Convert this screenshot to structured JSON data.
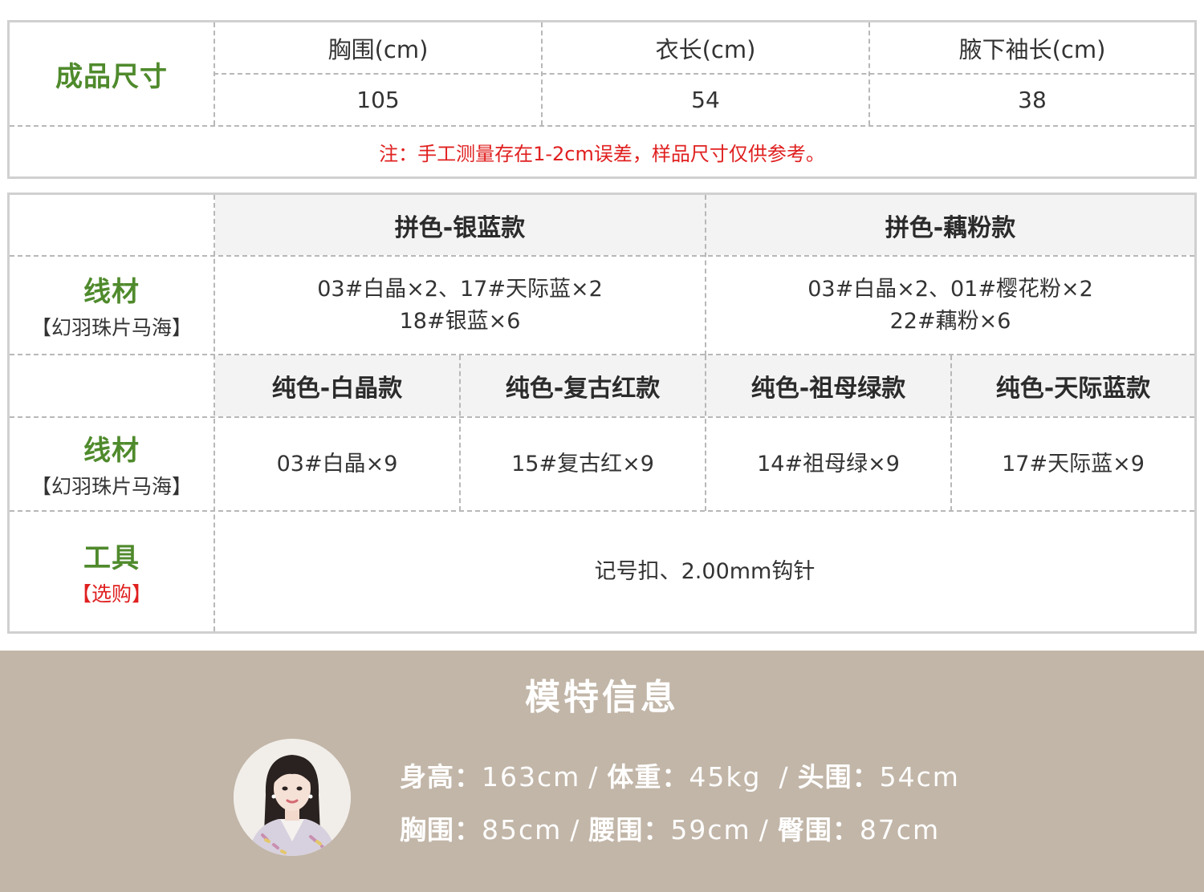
{
  "size_table": {
    "title": "成品尺寸",
    "columns": [
      "胸围(cm)",
      "衣长(cm)",
      "腋下袖长(cm)"
    ],
    "values": [
      "105",
      "54",
      "38"
    ],
    "note": "注：手工测量存在1-2cm误差，样品尺寸仅供参考。"
  },
  "material_table": {
    "material_label": "线材",
    "material_sublabel": "【幻羽珠片马海】",
    "mixed": [
      {
        "title": "拼色-银蓝款",
        "lines": [
          "03#白晶×2、17#天际蓝×2",
          "18#银蓝×6"
        ]
      },
      {
        "title": "拼色-藕粉款",
        "lines": [
          "03#白晶×2、01#樱花粉×2",
          "22#藕粉×6"
        ]
      }
    ],
    "solid": [
      {
        "title": "纯色-白晶款",
        "value": "03#白晶×9"
      },
      {
        "title": "纯色-复古红款",
        "value": "15#复古红×9"
      },
      {
        "title": "纯色-祖母绿款",
        "value": "14#祖母绿×9"
      },
      {
        "title": "纯色-天际蓝款",
        "value": "17#天际蓝×9"
      }
    ],
    "tools_label": "工具",
    "tools_sublabel": "【选购】",
    "tools_value": "记号扣、2.00mm钩针"
  },
  "model_info": {
    "title": "模特信息",
    "height_label": "身高：",
    "height": "163cm",
    "weight_label": "体重：",
    "weight": "45kg",
    "head_label": "头围：",
    "head": "54cm",
    "bust_label": "胸围：",
    "bust": "85cm",
    "waist_label": "腰围：",
    "waist": "59cm",
    "hip_label": "臀围：",
    "hip": "87cm",
    "separator": "/"
  }
}
